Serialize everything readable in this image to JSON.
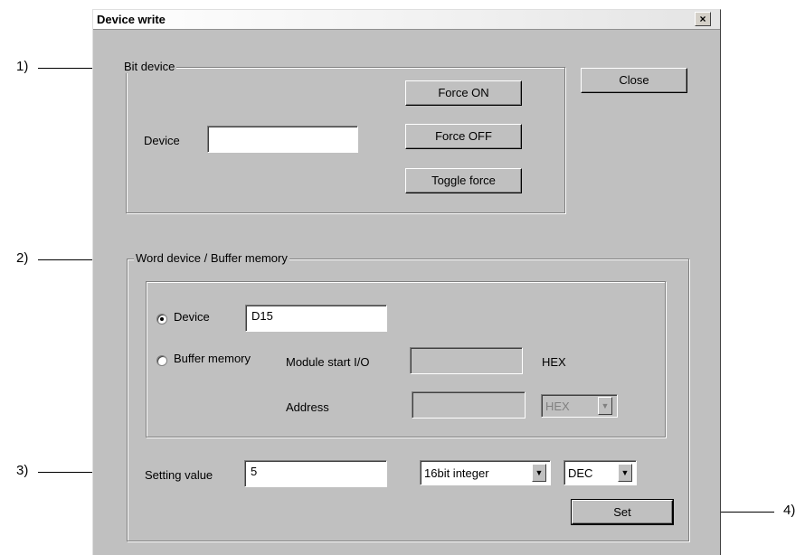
{
  "dialog": {
    "title": "Device write",
    "close_glyph": "×",
    "close_button": "Close"
  },
  "bit_device": {
    "group_label": "Bit device",
    "device_label": "Device",
    "device_value": "",
    "force_on": "Force ON",
    "force_off": "Force OFF",
    "toggle_force": "Toggle force"
  },
  "word_device": {
    "group_label": "Word device / Buffer memory",
    "device_radio_label": "Device",
    "device_selected": true,
    "device_value": "D15",
    "buffer_radio_label": "Buffer memory",
    "module_start_label": "Module start I/O",
    "module_start_value": "",
    "hex_label": "HEX",
    "address_label": "Address",
    "address_value": "",
    "address_format": "HEX"
  },
  "setting": {
    "label": "Setting value",
    "value": "5",
    "type_value": "16bit integer",
    "format_value": "DEC",
    "set_button": "Set"
  },
  "callouts": [
    "1)",
    "2)",
    "3)",
    "4)"
  ],
  "icons": {
    "dropdown": "▼"
  }
}
